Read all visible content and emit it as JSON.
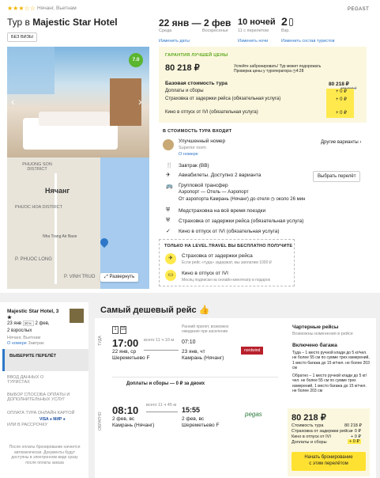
{
  "header": {
    "stars": "★★★☆☆",
    "location": "Нячанг, Вьетнам",
    "brand": "PEGAST",
    "title_prefix": "Тур в ",
    "hotel_name": "Majestic Star Hotel",
    "board": "БЕЗ ВИЗЫ",
    "dates": "22 янв — 2 фев",
    "dates_sub1": "Среда",
    "dates_sub2": "Воскресенье",
    "dates_link": "Изменить даты",
    "nights": "10 ночей",
    "nights_sub": "11 с перелетом",
    "nights_link": "Изменить ночи",
    "guests": "2",
    "guests_sub": "Взр.",
    "guests_link": "Изменить состав туристов"
  },
  "photo": {
    "rating": "7.0",
    "expand": "Развернуть",
    "map_labels": [
      "PHUONG SON DISTRICT",
      "Нячанг",
      "PHUOC HOA DISTRICT",
      "Nha Trang Air Base",
      "P. PHUOC LONG",
      "P. VINH TRUO"
    ]
  },
  "price_box": {
    "guarantee": "ГАРАНТИЯ ЛУЧШЕЙ ЦЕНЫ",
    "price": "80 218 ₽",
    "note1": "Успейте забронировать! Тур может подорожать",
    "note2": "Проверка цены у туроператора",
    "time": "4:28",
    "base_label": "Базовая стоимость тура",
    "base_value": "80 218 ₽",
    "old_price": "101 667 ₽",
    "rows": [
      {
        "label": "Доплаты и сборы",
        "value": "+ 0 ₽"
      },
      {
        "label": "Страховка от задержки рейса (обязательная услуга)",
        "value": "+ 0 ₽"
      },
      {
        "label": "Кино в отпуск от IVI (обязательная услуга)",
        "value": "+ 0 ₽"
      }
    ]
  },
  "included": {
    "title": "В СТОИМОСТЬ ТУРА ВХОДИТ",
    "room": "Улучшенный номер",
    "room_sub": "Superior room",
    "room_link": "О номере",
    "other": "Другие варианты",
    "breakfast": "Завтрак (BB)",
    "flights": "Авиабилеты. Доступно 2 варианта",
    "choose_flight": "Выбрать перелёт",
    "transfer": "Групповой трансфер",
    "transfer_sub1": "Аэропорт — Отель — Аэропорт",
    "transfer_sub2": "От аэропорта Камрань (Нячанг) до отеля",
    "transfer_time": "около 26 мин",
    "med": "Медстраховка на всё время поездки",
    "ins": "Страховка от задержки рейса (обязательная услуга)",
    "ivi": "Кино в отпуск от IVI (обязательная услуга)"
  },
  "free": {
    "title": "ТОЛЬКО НА LEVEL.TRAVEL ВЫ БЕСПЛАТНО ПОЛУЧИТЕ",
    "ins": "Страховка от задержки рейса",
    "ins_sub": "Если рейс «туда» задержат, мы заплатим 1000 ₽",
    "ivi": "Кино в отпуск от IVI",
    "ivi_sub": "Месяц подписки на онлайн-кинотеатр в подарок"
  },
  "sidebar": {
    "hotel": "Majestic Star Hotel, 3 ★",
    "dates": "23 янв",
    "nights_badge": "10 н.",
    "dates2": "2 фев,",
    "guests": "2 взрослых",
    "location": "Нячанг, Вьетнам",
    "room_link": "О номере",
    "meal": "Завтрак",
    "steps": [
      "ВЫБЕРИТЕ ПЕРЕЛЁТ",
      "ВВОД ДАННЫХ О ТУРИСТАХ",
      "ВЫБОР СПОСОБА ОПЛАТЫ И ДОПОЛНИТЕЛЬНЫХ УСЛУГ",
      "ОПЛАТА ТУРА ОНЛАЙН КАРТОЙ",
      "ИЛИ В РАССРОЧКУ"
    ],
    "pay_logos": "VISA ● МИР ●",
    "footer": "После оплаты бронирование начнется автоматически. Документы будут доступны в электронном виде сразу после оплаты заказа"
  },
  "flight": {
    "section_title": "Самый дешевый рейс",
    "there": "ТУДА",
    "back": "ОБРАТНО",
    "out_dep_time": "17:00",
    "out_dep_date": "22 янв, ср",
    "out_dep_airport": "Шереметьево F",
    "out_duration": "всего 11 ч 10 м",
    "out_arr_time": "07:10",
    "out_arr_date": "23 янв, чт",
    "out_arr_airport": "Камрань (Нячанг)",
    "out_note": "Ранний прилет, возможно ожидание при заселении",
    "out_airline": "nordwind",
    "fees": "Доплаты и сборы — 0 ₽ за двоих",
    "ret_dep_time": "08:10",
    "ret_dep_date": "2 фев, вс",
    "ret_dep_airport": "Камрань (Нячанг)",
    "ret_duration": "всего 11 ч 45 м",
    "ret_arr_time": "15:55",
    "ret_arr_date": "2 фев, вс",
    "ret_arr_airport": "Шереметьево F",
    "ret_airline": "pegas",
    "charter": "Чартерные рейсы",
    "charter_sub": "Возможны изменения в рейсе",
    "baggage": "Включено багажа",
    "bag_text1": "Туда – 1 место ручной клади до 5 кг/чел. не более 55 см по сумме трех измерений, 1 место багажа до 15 кг/чел. не более 203 см",
    "bag_text2": "Обратно – 1 место ручной клади до 5 кг/чел. не более 55 см по сумме трех измерений, 1 место багажа до 15 кг/чел. не более 203 см",
    "total": "80 218 ₽",
    "total_rows": [
      {
        "label": "Стоимость тура",
        "value": "80 218 ₽"
      },
      {
        "label": "Страховка от задержки рейса",
        "value": "+ 0 ₽"
      },
      {
        "label": "Кино в отпуск от IVI",
        "value": "+ 0 ₽"
      },
      {
        "label": "Доплаты и сборы",
        "value": "+ 0 ₽"
      }
    ],
    "book_btn1": "Начать бронирование",
    "book_btn2": "с этим перелётом"
  }
}
